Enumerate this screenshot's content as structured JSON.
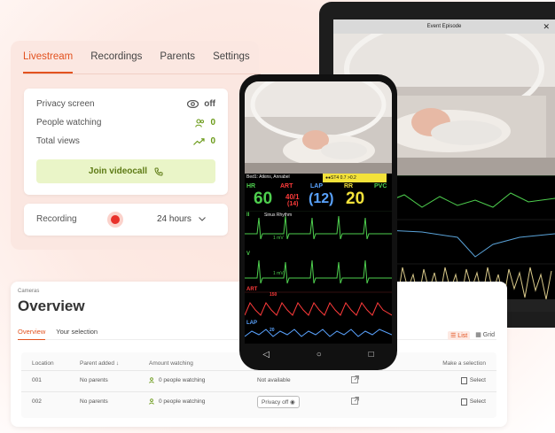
{
  "livestream": {
    "tabs": [
      "Livestream",
      "Recordings",
      "Parents",
      "Settings"
    ],
    "privacy_label": "Privacy screen",
    "privacy_value": "off",
    "people_label": "People watching",
    "people_value": "0",
    "views_label": "Total views",
    "views_value": "0",
    "join_label": "Join videocall",
    "recording_label": "Recording",
    "recording_duration": "24 hours"
  },
  "overview": {
    "breadcrumb": "Cameras",
    "title": "Overview",
    "tabs": [
      "Overview",
      "Your selection"
    ],
    "view_list": "List",
    "view_grid": "Grid",
    "columns": [
      "Location",
      "Parent added ↓",
      "Amount watching",
      "",
      "",
      "Make a selection"
    ],
    "rows": [
      {
        "location": "001",
        "parent": "No parents",
        "watching": "0 people watching",
        "privacy": "Not available",
        "select": "Select"
      },
      {
        "location": "002",
        "parent": "No parents",
        "watching": "0 people watching",
        "privacy": "Privacy off",
        "select": "Select"
      }
    ]
  },
  "tablet": {
    "window_title": "Event Episode"
  },
  "monitor": {
    "bed_label": "Bed1: Atkins, Annabel",
    "alarm_text": "●●ST4 0.7 >0.2",
    "hr_label": "HR",
    "hr_value": "60",
    "art_label": "ART",
    "art_value": "40/1",
    "art_mean": "(14)",
    "lap_label": "LAP",
    "lap_value": "(12)",
    "rr_label": "RR",
    "rr_value": "20",
    "pvc_label": "PVC",
    "ii_label": "II",
    "rhythm": "Sinus Rhythm",
    "mv1": "1 mV",
    "v_label": "V",
    "mv2": "1 mV",
    "art_wave_label": "ART",
    "art_scale": "150",
    "lap_wave_label": "LAP",
    "lap_scale": "20"
  },
  "colors": {
    "accent": "#e2521f",
    "green": "#6a9a18",
    "join_bg": "#eaf5c8",
    "record": "#e8312a"
  }
}
